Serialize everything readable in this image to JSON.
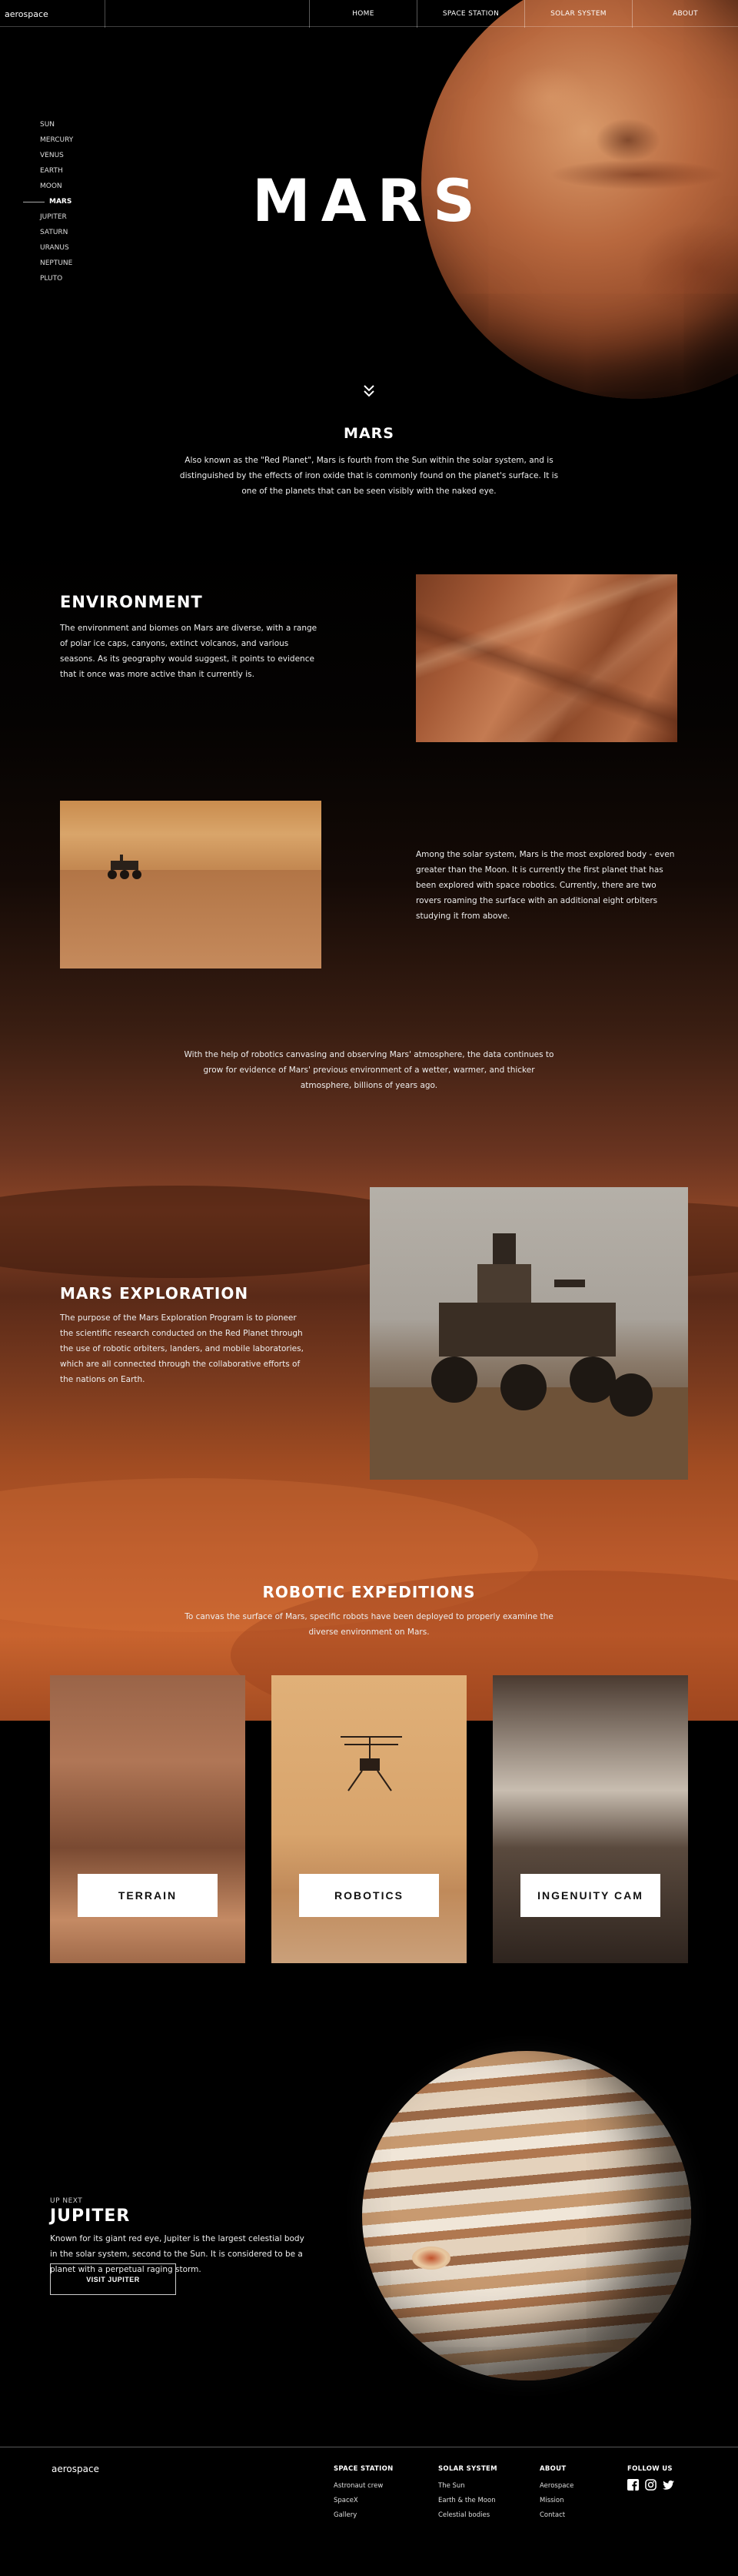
{
  "header": {
    "logo": "aerospace",
    "nav": [
      "HOME",
      "SPACE STATION",
      "SOLAR SYSTEM",
      "ABOUT"
    ]
  },
  "sidebar": {
    "planets": [
      "SUN",
      "MERCURY",
      "VENUS",
      "EARTH",
      "MOON",
      "MARS",
      "JUPITER",
      "SATURN",
      "URANUS",
      "NEPTUNE",
      "PLUTO"
    ],
    "active": "MARS"
  },
  "hero": {
    "title": "MARS",
    "scroll_icon": "double-chevron-down-icon"
  },
  "intro": {
    "title": "MARS",
    "text": "Also known as the \"Red Planet\", Mars is fourth from the Sun within the solar system, and is distinguished by the effects of iron oxide that is commonly found on the planet's surface. It is one of the planets that can be seen visibly with the naked eye."
  },
  "environment": {
    "title": "ENVIRONMENT",
    "text": "The environment and biomes on Mars are diverse, with a range of polar ice caps, canyons, extinct volcanos, and various seasons. As its geography would suggest, it points to evidence that it once was more active than it currently is."
  },
  "rovers": {
    "text": "Among the solar system, Mars is the most explored body - even greater than the Moon. It is currently the first planet that has been explored with space robotics. Currently, there are two rovers roaming the surface with an additional eight orbiters studying it from above."
  },
  "quote": {
    "text": "With the help of robotics canvasing and observing Mars' atmosphere, the data continues to grow for evidence of Mars' previous environment of a wetter, warmer, and thicker atmosphere, billions of years ago."
  },
  "exploration": {
    "title": "MARS EXPLORATION",
    "text": "The purpose of the Mars Exploration Program is to pioneer the scientific research conducted on the Red Planet through the use of robotic orbiters, landers, and mobile laboratories, which are all connected through the collaborative efforts of the nations on Earth."
  },
  "robotic": {
    "title": "ROBOTIC EXPEDITIONS",
    "text": "To canvas the surface of Mars, specific robots have been deployed to properly examine the diverse environment on Mars."
  },
  "cards": [
    {
      "label": "TERRAIN"
    },
    {
      "label": "ROBOTICS"
    },
    {
      "label": "INGENUITY CAM"
    }
  ],
  "up_next": {
    "label": "UP NEXT",
    "title": "JUPITER",
    "text": "Known for its giant red eye, Jupiter is the largest celestial body in the solar system, second to the Sun. It is considered to be a planet with a perpetual raging storm.",
    "button": "VISIT JUPITER"
  },
  "footer": {
    "logo": "aerospace",
    "columns": [
      {
        "title": "SPACE STATION",
        "links": [
          "Astronaut crew",
          "SpaceX",
          "Gallery"
        ]
      },
      {
        "title": "SOLAR SYSTEM",
        "links": [
          "The Sun",
          "Earth & the Moon",
          "Celestial bodies"
        ]
      },
      {
        "title": "ABOUT",
        "links": [
          "Aerospace",
          "Mission",
          "Contact"
        ]
      }
    ],
    "follow": {
      "title": "FOLLOW US",
      "icons": [
        "facebook-icon",
        "instagram-icon",
        "twitter-icon"
      ]
    }
  }
}
